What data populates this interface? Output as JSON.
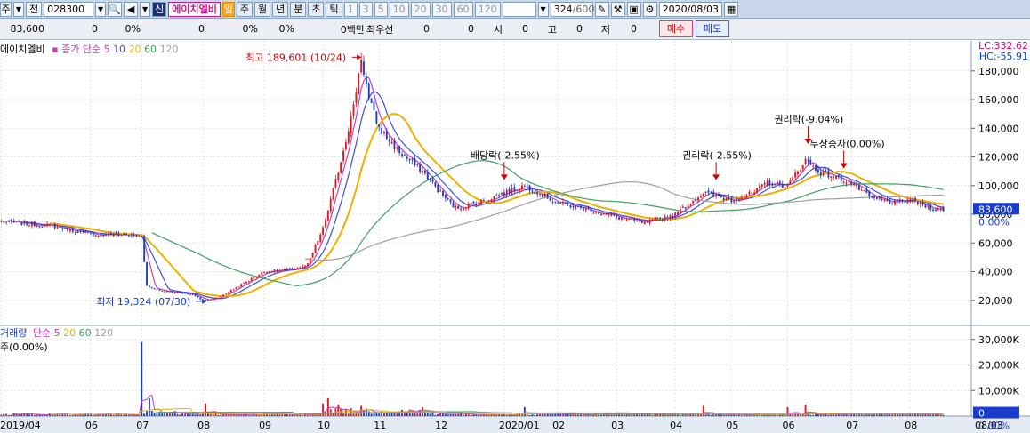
{
  "toolbar": {
    "prefix_label": "주",
    "jeon_label": "전",
    "code": "028300",
    "sin_badge": "신",
    "stock_name": "에이치엘비",
    "il_label": "일",
    "periods": [
      "주",
      "월",
      "년",
      "분",
      "초",
      "틱"
    ],
    "numbers": [
      "1",
      "3",
      "5",
      "10",
      "20",
      "30",
      "60",
      "120"
    ],
    "range_value": "324",
    "range_max": "/600",
    "date_value": "2020/08/03"
  },
  "info": {
    "price": "83,600",
    "v1": "0",
    "v2": "0%",
    "v3": "0",
    "v4": "0%",
    "v5": "0%",
    "unit": "0백만",
    "best_label": "최우선",
    "v6": "0",
    "v7": "0",
    "si_label": "시",
    "si_value": "0",
    "go_label": "고",
    "go_value": "0",
    "jeo_label": "저",
    "jeo_value": "0",
    "buy_label": "매수",
    "sell_label": "매도"
  },
  "legend": {
    "name": "에이치엘비",
    "kind": "종가 단순",
    "ma5": "5",
    "ma10": "10",
    "ma20": "20",
    "ma60": "60",
    "ma120": "120"
  },
  "vol_legend": {
    "name": "거래량",
    "kind": "단순",
    "ma5": "5",
    "ma20": "20",
    "ma60": "60",
    "ma120": "120",
    "unit_text": "주(0.00%)"
  },
  "top_right": {
    "lc": "LC:332.62",
    "hc": "HC:-55.91"
  },
  "colors": {
    "up": "#e8151b",
    "down": "#1a3cc8",
    "ma5": "#c040c0",
    "ma10": "#4050d0",
    "ma20": "#f0b000",
    "ma60": "#40a060",
    "ma120": "#a0a0a0"
  },
  "chart_data": {
    "type": "candlestick",
    "price_axis_ticks": [
      20000,
      40000,
      60000,
      80000,
      100000,
      120000,
      140000,
      160000,
      180000
    ],
    "price_axis_labels": [
      "20,000",
      "40,000",
      "60,000",
      "80,000",
      "100,000",
      "120,000",
      "140,000",
      "160,000",
      "180,000"
    ],
    "ylim": [
      5000,
      196000
    ],
    "current_price_label": "83,600",
    "current_pct_label": "0.00%",
    "volume_axis_ticks": [
      10000,
      20000,
      30000
    ],
    "volume_axis_labels": [
      "10,000K",
      "20,000K",
      "30,000K"
    ],
    "volume_current_label": "0",
    "volume_pct_label": "0.00%",
    "vol_ylim": [
      0,
      32000
    ],
    "x_labels": [
      "2019/04",
      "06",
      "07",
      "08",
      "09",
      "10",
      "11",
      "12",
      "2020/01",
      "02",
      "03",
      "04",
      "05",
      "06",
      "07",
      "08",
      "08/03"
    ],
    "x_label_positions": [
      0,
      35,
      55,
      79,
      103,
      126,
      148,
      172,
      197,
      218,
      241,
      264,
      286,
      308,
      333,
      356,
      370
    ],
    "total_bars": 370,
    "price_keyframes": [
      [
        0,
        75000
      ],
      [
        20,
        72000
      ],
      [
        35,
        66000
      ],
      [
        50,
        66000
      ],
      [
        55,
        64000
      ],
      [
        57,
        30000
      ],
      [
        62,
        27000
      ],
      [
        75,
        24000
      ],
      [
        79,
        20000
      ],
      [
        85,
        22000
      ],
      [
        95,
        32000
      ],
      [
        103,
        40000
      ],
      [
        115,
        42000
      ],
      [
        120,
        45000
      ],
      [
        126,
        70000
      ],
      [
        132,
        110000
      ],
      [
        138,
        155000
      ],
      [
        141,
        189601
      ],
      [
        144,
        160000
      ],
      [
        148,
        140000
      ],
      [
        155,
        125000
      ],
      [
        165,
        110000
      ],
      [
        172,
        95000
      ],
      [
        178,
        84000
      ],
      [
        190,
        90000
      ],
      [
        197,
        95000
      ],
      [
        205,
        100000
      ],
      [
        218,
        88000
      ],
      [
        228,
        84000
      ],
      [
        241,
        78000
      ],
      [
        252,
        74000
      ],
      [
        264,
        80000
      ],
      [
        275,
        95000
      ],
      [
        286,
        90000
      ],
      [
        295,
        95000
      ],
      [
        300,
        102000
      ],
      [
        308,
        100000
      ],
      [
        315,
        118000
      ],
      [
        320,
        110000
      ],
      [
        333,
        102000
      ],
      [
        340,
        92000
      ],
      [
        350,
        88000
      ],
      [
        356,
        90000
      ],
      [
        362,
        86000
      ],
      [
        366,
        83600
      ]
    ],
    "volume_spikes": [
      [
        55,
        29000
      ],
      [
        58,
        7000
      ],
      [
        80,
        5000
      ],
      [
        126,
        5000
      ],
      [
        128,
        7000
      ],
      [
        132,
        4500
      ],
      [
        141,
        4000
      ],
      [
        165,
        3500
      ],
      [
        205,
        3500
      ],
      [
        275,
        4000
      ],
      [
        308,
        3500
      ],
      [
        315,
        4500
      ]
    ],
    "annotations": [
      {
        "text": "최고 189,601 (10/24)",
        "bar": 141,
        "value": 189601,
        "kind": "high"
      },
      {
        "text": "최저 19,324 (07/30)",
        "bar": 79,
        "value": 19324,
        "kind": "low"
      },
      {
        "text": "배당락(-2.55%)",
        "bar": 197,
        "value": 104000,
        "kind": "event"
      },
      {
        "text": "권리락(-2.55%)",
        "bar": 280,
        "value": 104000,
        "kind": "event"
      },
      {
        "text": "권리락(-9.04%)",
        "bar": 316,
        "value": 129000,
        "kind": "event"
      },
      {
        "text": "무상증자(0.00%)",
        "bar": 330,
        "value": 112000,
        "kind": "event"
      }
    ]
  }
}
